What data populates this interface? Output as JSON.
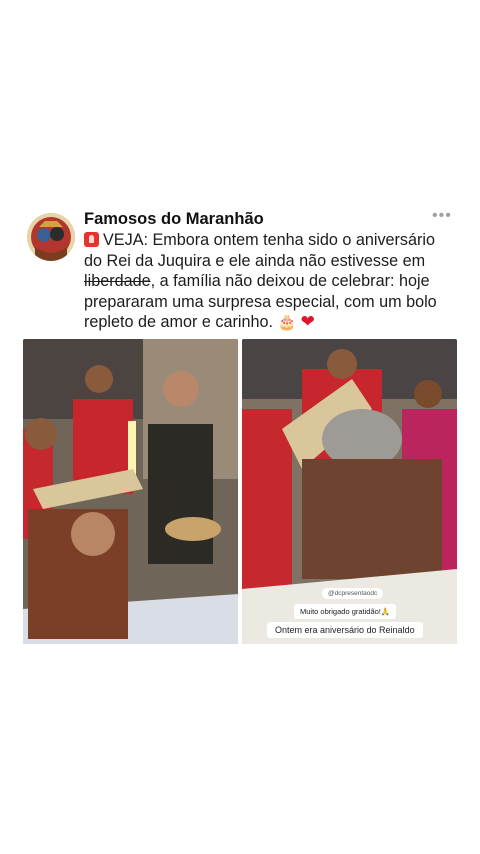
{
  "post": {
    "author": "Famosos do Maranhão",
    "more_icon": "more-dots-icon",
    "lines": {
      "l1_text": "VEJA: Embora ontem tenha sido o aniversário",
      "l2": "do Rei da Juquira e ele ainda não estivesse em",
      "l3_strike": "liberdade",
      "l3_rest": ", a família não deixou de celebrar: hoje",
      "l4": "prepararam uma surpresa especial, com um bolo",
      "l5": "repleto de amor e carinho."
    },
    "emojis": {
      "siren": "siren-icon",
      "cake": "🎂",
      "heart": "❤"
    }
  },
  "media": {
    "right_overlay": {
      "tag": "@dcpresentaodc",
      "thanks": "Muito obrigado gratidão!🙏",
      "caption": "Ontem era aniversário do Reinaldo"
    }
  },
  "colors": {
    "red_shirts": "#c8202a",
    "wall": "#8a7b6b"
  }
}
